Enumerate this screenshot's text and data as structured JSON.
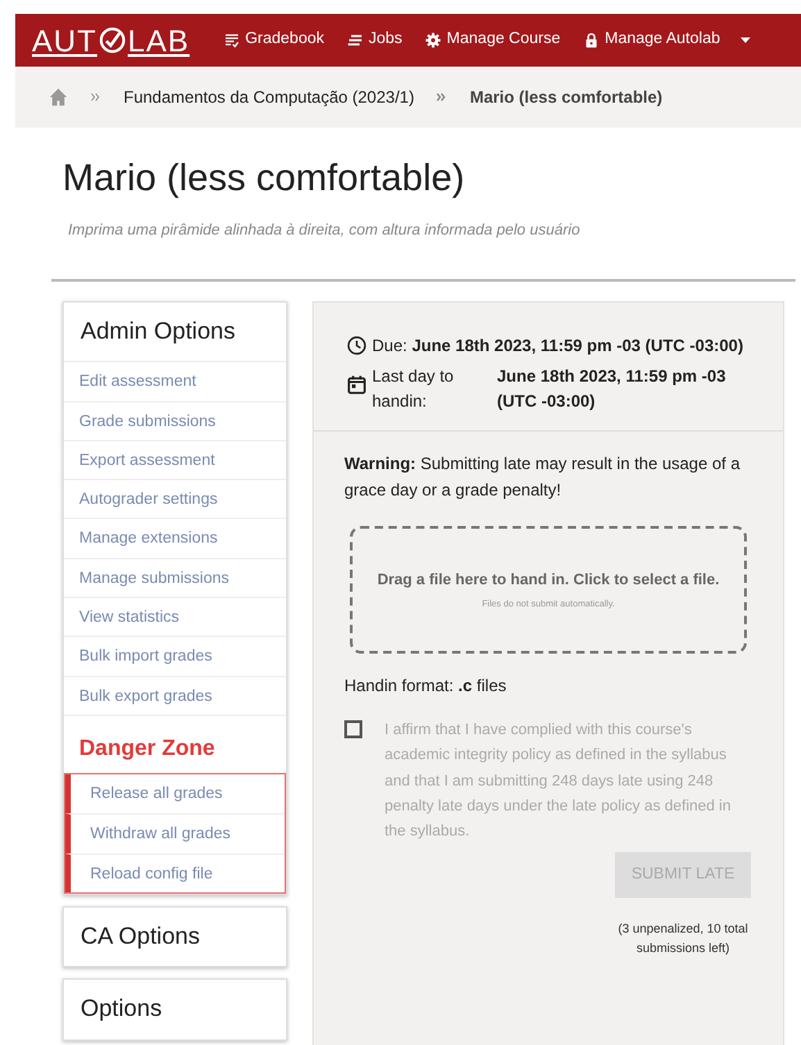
{
  "navbar": {
    "logo_left": "AUT",
    "logo_right": "LAB",
    "items": [
      {
        "kind": "gradebook",
        "label": "Gradebook"
      },
      {
        "kind": "jobs",
        "label": "Jobs"
      },
      {
        "kind": "gear",
        "label": "Manage Course"
      },
      {
        "kind": "lock",
        "label": "Manage Autolab"
      }
    ]
  },
  "breadcrumb": [
    {
      "kind": "home"
    },
    {
      "kind": "link",
      "label": "Fundamentos da Computação (2023/1)"
    },
    {
      "kind": "current",
      "label": "Mario (less comfortable)"
    }
  ],
  "title": "Mario (less comfortable)",
  "subtitle": "Imprima uma pirâmide alinhada à direita, com altura informada pelo usuário",
  "sidebar": {
    "admin_title": "Admin Options",
    "admin_items": [
      "Edit assessment",
      "Grade submissions",
      "Export assessment",
      "Autograder settings",
      "Manage extensions",
      "Manage submissions",
      "View statistics",
      "Bulk import grades",
      "Bulk export grades"
    ],
    "danger_title": "Danger Zone",
    "danger_items": [
      "Release all grades",
      "Withdraw all grades",
      "Reload config file"
    ],
    "other_cards": [
      "CA Options",
      "Options"
    ]
  },
  "handin": {
    "due": "Due: **June 18th 2023, 11:59 pm -03 (UTC -03:00)**",
    "last_day_label": "Last day to handin:",
    "last_day_value": "June 18th 2023, 11:59 pm -03 (UTC -03:00)",
    "warning": "**Warning:** Submitting late may result in the usage of a grace day or a grade penalty!",
    "dropzone_text": "Drag a file here to hand in. Click to select a file.",
    "dropzone_note": "Files do not submit automatically.",
    "format": "Handin format: **.c** files",
    "affirm": {
      "checked": false,
      "text": "I affirm that I have complied with this course's academic integrity policy as defined in the syllabus and that I am submitting 248 days late using 248 penalty late days under the late policy as defined in the syllabus."
    },
    "submit": {
      "label": "SUBMIT LATE",
      "disabled": true
    },
    "remaining": "(3 unpenalized, 10 total submissions left)"
  }
}
